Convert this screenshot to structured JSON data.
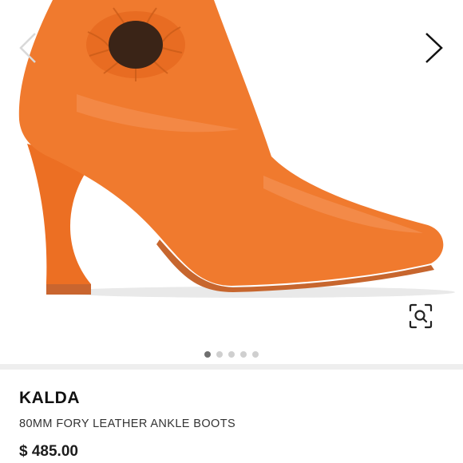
{
  "gallery": {
    "prev_icon": "chevron-left-icon",
    "next_icon": "chevron-right-icon",
    "zoom_icon": "visual-search-icon",
    "image_subject": "orange leather ankle boot",
    "slide_count": 5,
    "active_slide": 1,
    "colors": {
      "product": "#f07a2e",
      "prev_arrow": "#d9d9d9",
      "next_arrow": "#111111",
      "dot_active": "#6f6f6f",
      "dot_inactive": "#cfcfcf"
    }
  },
  "product": {
    "brand": "KALDA",
    "name": "80MM FORY LEATHER ANKLE BOOTS",
    "price": "$ 485.00"
  }
}
